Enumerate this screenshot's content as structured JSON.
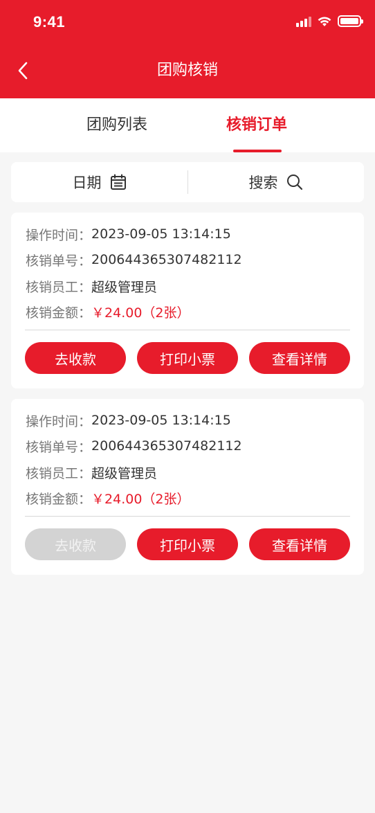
{
  "status_bar": {
    "time": "9:41"
  },
  "header": {
    "title": "团购核销"
  },
  "tabs": [
    {
      "label": "团购列表",
      "active": false
    },
    {
      "label": "核销订单",
      "active": true
    }
  ],
  "filters": {
    "date_label": "日期",
    "search_label": "搜索"
  },
  "orders": [
    {
      "time_label": "操作时间：",
      "time": "2023-09-05 13:14:15",
      "order_no_label": "核销单号：",
      "order_no": "200644365307482112",
      "staff_label": "核销员工：",
      "staff": "超级管理员",
      "amount_label": "核销金额：",
      "amount": "￥24.00（2张）",
      "collect_label": "去收款",
      "collect_enabled": true,
      "print_label": "打印小票",
      "detail_label": "查看详情"
    },
    {
      "time_label": "操作时间：",
      "time": "2023-09-05 13:14:15",
      "order_no_label": "核销单号：",
      "order_no": "200644365307482112",
      "staff_label": "核销员工：",
      "staff": "超级管理员",
      "amount_label": "核销金额：",
      "amount": "￥24.00（2张）",
      "collect_label": "去收款",
      "collect_enabled": false,
      "print_label": "打印小票",
      "detail_label": "查看详情"
    }
  ],
  "colors": {
    "brand": "#e71c2b",
    "background": "#f6f6f6",
    "disabled": "#d3d3d3"
  }
}
